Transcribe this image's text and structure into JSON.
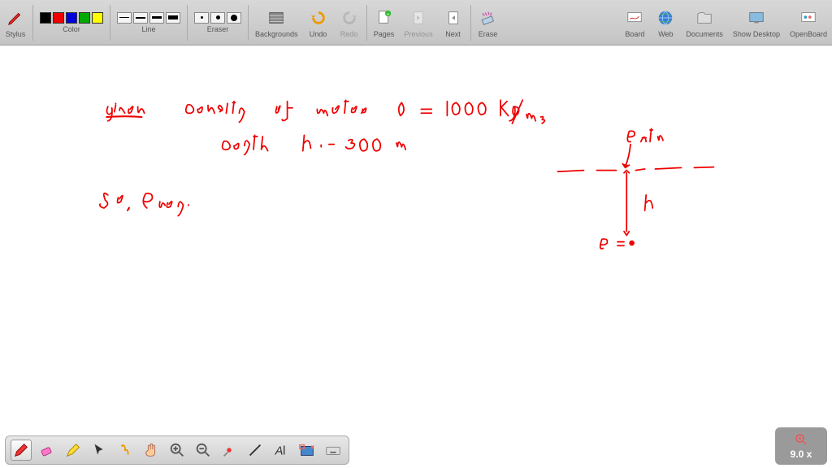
{
  "app": "OpenBoard",
  "toolbar": {
    "stylus": "Stylus",
    "color": "Color",
    "line": "Line",
    "eraser": "Eraser",
    "backgrounds": "Backgrounds",
    "undo": "Undo",
    "redo": "Redo",
    "pages": "Pages",
    "previous": "Previous",
    "next": "Next",
    "erase": "Erase",
    "board": "Board",
    "web": "Web",
    "documents": "Documents",
    "show_desktop": "Show Desktop",
    "openboard": "OpenBoard"
  },
  "zoom": {
    "level": "9.0 x"
  },
  "colors": [
    "black",
    "red",
    "blue",
    "green",
    "yellow"
  ],
  "selected_color": "red",
  "dock_tools": [
    "pen",
    "eraser",
    "highlighter",
    "pointer",
    "play",
    "hand",
    "zoom-in",
    "zoom-out",
    "laser",
    "line",
    "text",
    "crop",
    "keyboard"
  ],
  "handwriting": {
    "given_label": "given",
    "line1": "density of water  ρ = 1000 kg/m³",
    "line2": "depth  h = 300 m",
    "line3": "So, Press.",
    "diagram": {
      "top_label": "Patm",
      "depth_label": "h",
      "bottom_label": "P"
    }
  }
}
